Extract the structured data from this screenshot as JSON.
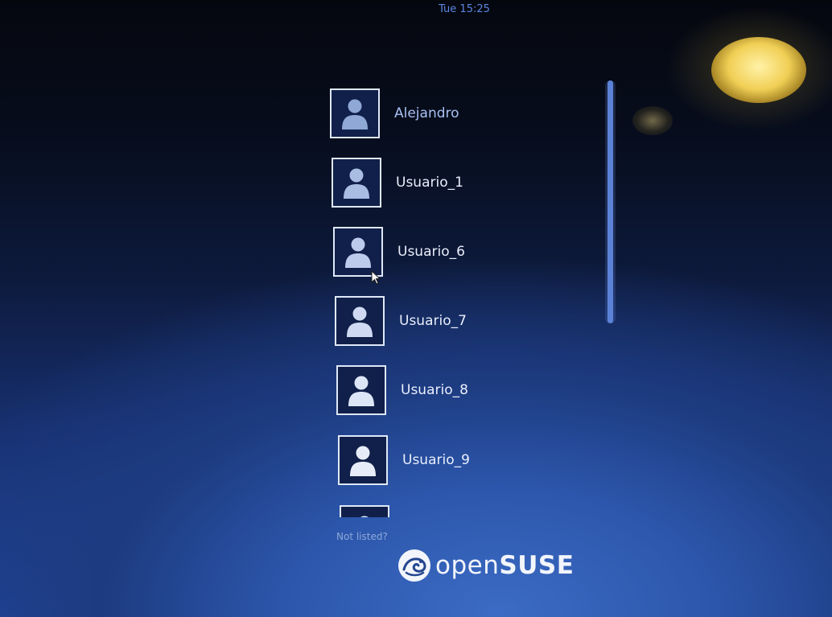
{
  "top_bar": {
    "clock": "Tue 15:25"
  },
  "users": [
    {
      "name": "Alejandro"
    },
    {
      "name": "Usuario_1"
    },
    {
      "name": "Usuario_6"
    },
    {
      "name": "Usuario_7"
    },
    {
      "name": "Usuario_8"
    },
    {
      "name": "Usuario_9"
    },
    {
      "name": ""
    }
  ],
  "not_listed_link": "Not listed?",
  "branding": {
    "logo_icon": "opensuse-chameleon-icon",
    "word_light": "open",
    "word_bold": "SUSE",
    "color": "#f2f5fb"
  },
  "colors": {
    "accent": "#5b82d6",
    "clock": "#5a86e0",
    "avatar_border": "#dfe8f8"
  }
}
